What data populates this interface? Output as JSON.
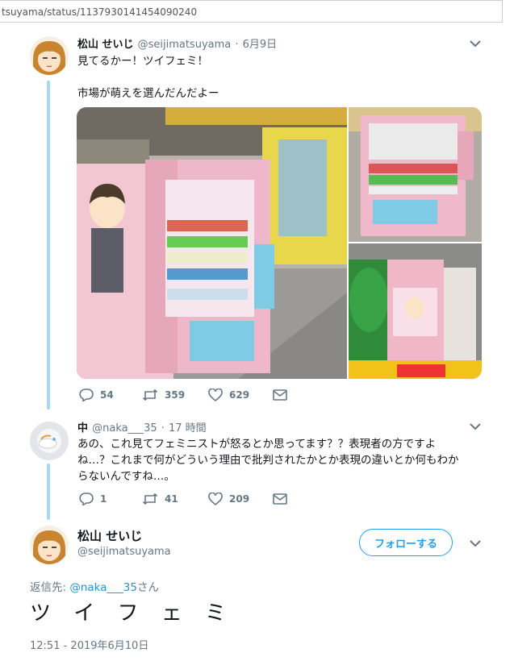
{
  "browser": {
    "url": "tsuyama/status/1137930141454090240"
  },
  "tweet1": {
    "display_name": "松山 せいじ",
    "handle": "@seijimatsuyama",
    "date": "6月9日",
    "text_line1": "見てるかー！ツイフェミ！",
    "text_line2": "市場が萌えを選んだんだよー",
    "replies": "54",
    "retweets": "359",
    "likes": "629"
  },
  "tweet2": {
    "display_name": "中",
    "handle": "@naka___35",
    "time": "17 時間",
    "text_line1": "あの、これ見てフェミニストが怒るとか思ってます？？表現者の方ですよ",
    "text_line2": "ね…？これまで何がどういう理由で批判されたかとか表現の違いとか何もわか",
    "text_line3": "らないんですね…。",
    "replies": "1",
    "retweets": "41",
    "likes": "209"
  },
  "focused": {
    "display_name": "松山 せいじ",
    "handle": "@seijimatsuyama",
    "follow_label": "フォローする",
    "reply_prefix": "返信先: ",
    "reply_to": "@naka___35",
    "reply_suffix": "さん",
    "text": "ツ イ フ ェ ミ",
    "timestamp": "12:51 - 2019年6月10日"
  },
  "colors": {
    "accent": "#1da1f2",
    "thread_line": "#a8d8f4",
    "muted": "#657786"
  },
  "icons": [
    "reply-icon",
    "retweet-icon",
    "like-icon",
    "dm-icon",
    "chevron-down-icon"
  ]
}
